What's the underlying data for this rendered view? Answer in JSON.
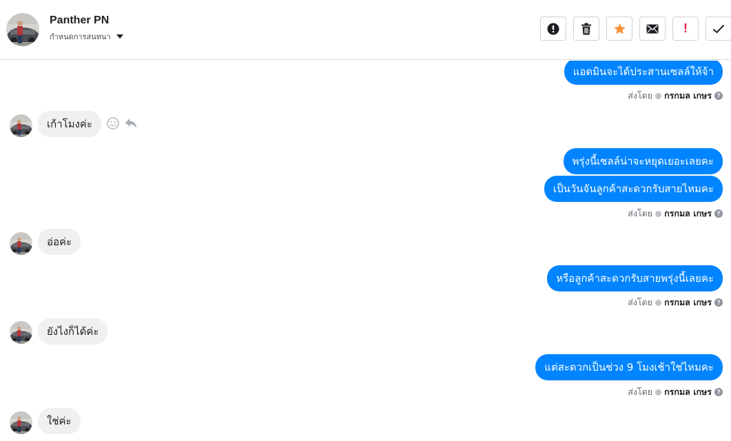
{
  "header": {
    "name": "Panther PN",
    "subtitle": "กำหนดการสนทนา"
  },
  "toolbar": {
    "buttons": [
      {
        "icon": "alert-circle-icon"
      },
      {
        "icon": "trash-icon"
      },
      {
        "icon": "star-icon",
        "color": "#f5923e"
      },
      {
        "icon": "envelope-icon"
      },
      {
        "icon": "exclamation-icon",
        "label": "!",
        "color": "#e41e3f"
      },
      {
        "icon": "check-icon"
      }
    ]
  },
  "sent_by": {
    "prefix": "ส่งโดย",
    "name": "กรกมล เกษร",
    "help": "?"
  },
  "messages": [
    {
      "dir": "out",
      "text": "แอดมินจะได้ประสานเซลล์ให้จ้า"
    },
    {
      "dir": "in",
      "text": "เก้าโมงค่ะ"
    },
    {
      "dir": "out",
      "text": "พรุ่งนี้เซลล์น่าจะหยุดเยอะเลยคะ"
    },
    {
      "dir": "out",
      "text": "เป็นวันจันลูกค้าสะดวกรับสายไหมคะ"
    },
    {
      "dir": "in",
      "text": "อ่อค่ะ"
    },
    {
      "dir": "out",
      "text": "หรือลูกค้าสะดวกรับสายพรุ่งนี้เลยคะ"
    },
    {
      "dir": "in",
      "text": "ยังไงก็ได้ค่ะ"
    },
    {
      "dir": "out",
      "text": "แต่สะดวกเป็นช่วง 9 โมงเช้าใช่ไหมคะ"
    },
    {
      "dir": "in",
      "text": "ใช่ค่ะ"
    }
  ],
  "colors": {
    "outgoing_bubble": "#0084ff",
    "incoming_bubble": "#f1f0f0"
  }
}
